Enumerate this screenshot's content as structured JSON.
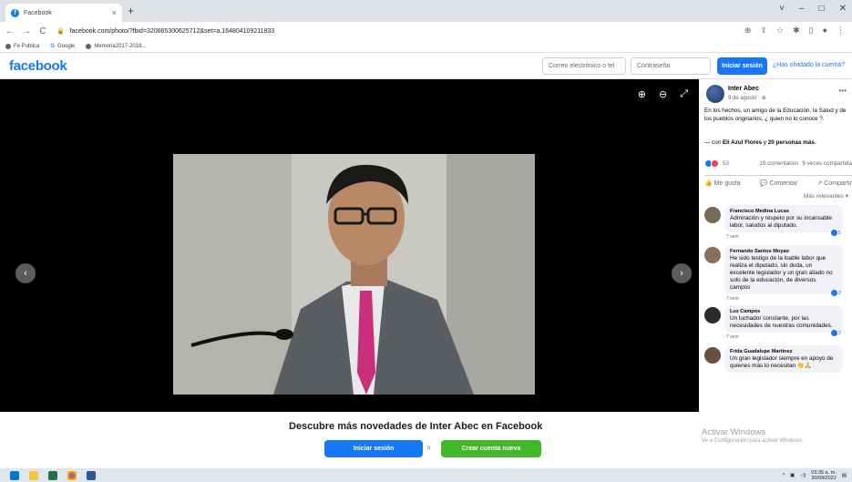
{
  "browser": {
    "tab_title": "Facebook",
    "tab_close": "×",
    "new_tab": "+",
    "url": "facebook.com/photo/?fbid=320665300625712&set=a.164804109211833",
    "bookmarks": [
      "Fe Publica",
      "Google",
      "Memoria2017-2018..."
    ],
    "window_controls": [
      "˅",
      "–",
      "□",
      "✕"
    ]
  },
  "fb_header": {
    "logo": "facebook",
    "email_placeholder": "Correo electrónico o tel",
    "password_placeholder": "Contraseña",
    "login_button": "Iniciar sesión",
    "forgot_link": "¿Has olvidado la cuenta?"
  },
  "post": {
    "author": "Inter Abec",
    "date": "9 de agosto · ",
    "text": "En los hechos, un amigo de la Educación, la Salud y de los pueblos originarios, ¿ quien no lo conoce ?.",
    "with_prefix": "— con ",
    "with_person": "Eli Azul Flores",
    "with_mid": " y ",
    "with_others": "20 personas más",
    "with_end": ".",
    "reactions_count": "53",
    "comments_count": "19 comentarios",
    "shares_count": "9 veces compartida",
    "like_label": "Me gusta",
    "comment_label": "Comentar",
    "share_label": "Compartir",
    "sort_label": "Más relevantes ▾"
  },
  "comments": [
    {
      "name": "Francisco Medina Lucas",
      "text": "Admiración y respeto por su incansable labor, saludos al diputado.",
      "time": "7 sem",
      "likes": "5",
      "avatar_color": "#7a6a58"
    },
    {
      "name": "Fernando Santos Moyao",
      "text": "He sido testigo de la loable labor que realiza el diputado, sin duda, un excelente legislador y un gran aliado no solo de la educación, de diversos campos",
      "time": "7 sem",
      "likes": "2",
      "avatar_color": "#8a6e5c"
    },
    {
      "name": "Luz Campos",
      "text": "Un luchador constante, por las necesidades de nuestras comunidades.",
      "time": "7 sem",
      "likes": "2",
      "avatar_color": "#2b2b2b"
    },
    {
      "name": "Frida Guadalupe Martinez",
      "text": "Un gran legislador siempre en apoyo de quienes más lo necesitan 👏🙏",
      "time": "",
      "likes": "",
      "avatar_color": "#6b5040"
    }
  ],
  "bottom": {
    "discover": "Descubre más novedades de Inter Abec en Facebook",
    "login_button": "Iniciar sesión",
    "or": "o",
    "create_button": "Crear cuenta nueva"
  },
  "watermark": {
    "line1": "Activar Windows",
    "line2": "Ve a Configuración para activar Windows."
  },
  "taskbar": {
    "time": "03:35 a. m.",
    "date": "30/09/2022"
  },
  "colors": {
    "brand": "#1877f2",
    "green": "#42b72a"
  }
}
